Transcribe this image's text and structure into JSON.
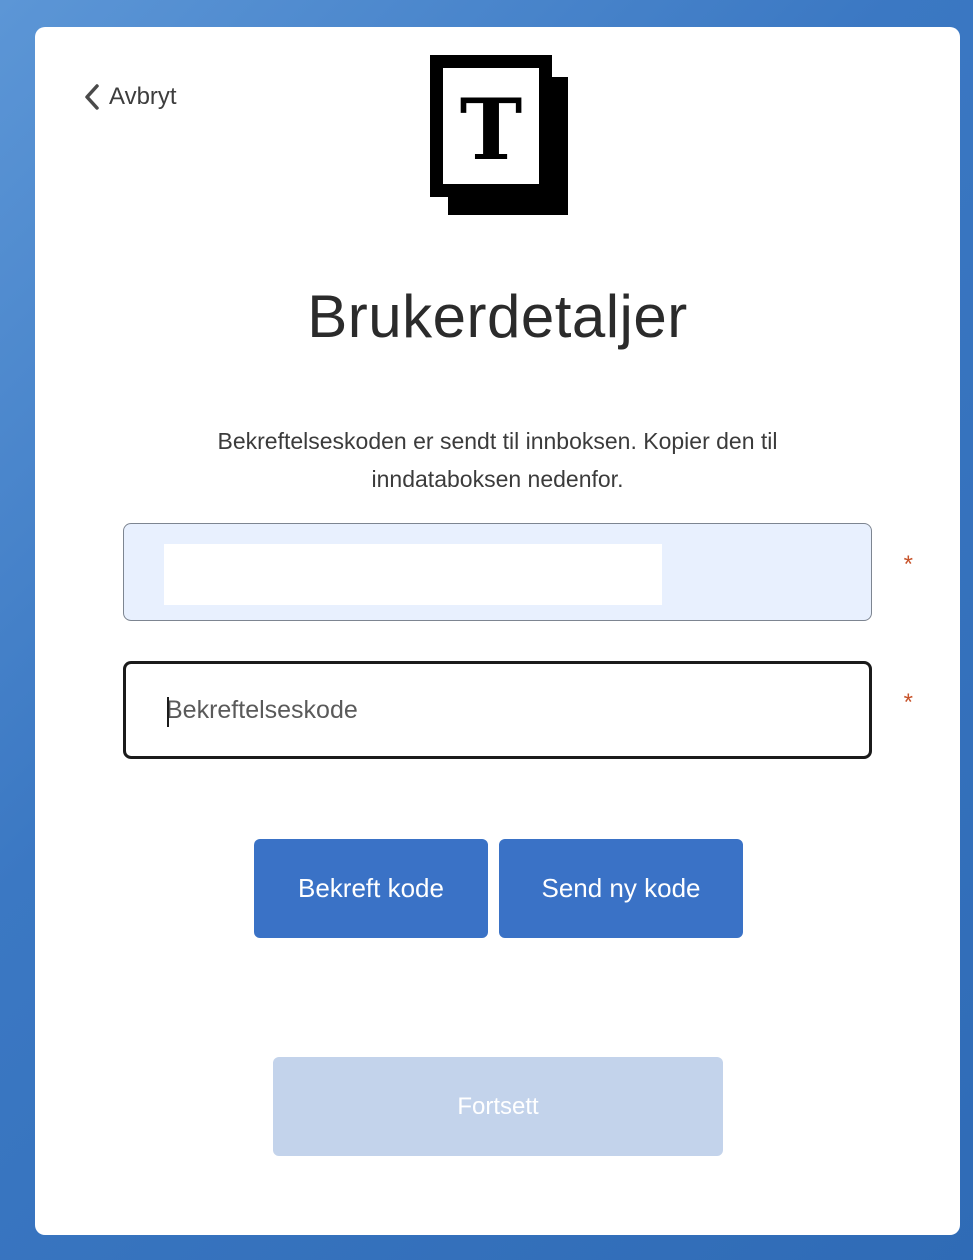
{
  "header": {
    "cancel_label": "Avbryt",
    "logo_letter": "T"
  },
  "main": {
    "title": "Brukerdetaljer",
    "description": "Bekreftelseskoden er sendt til innboksen. Kopier den til inndataboksen nedenfor.",
    "email_field": {
      "value": "",
      "required_marker": "*"
    },
    "code_field": {
      "value": "",
      "placeholder": "Bekreftelseskode",
      "required_marker": "*"
    },
    "buttons": {
      "confirm_label": "Bekreft kode",
      "resend_label": "Send ny kode",
      "continue_label": "Fortsett"
    }
  },
  "colors": {
    "background": "#3a78c2",
    "primary_button": "#3a72c6",
    "disabled_button": "#c3d3eb",
    "required_marker": "#c7532a",
    "autofill_field": "#e8f0fe"
  },
  "icons": {
    "back": "chevron-left-icon"
  }
}
